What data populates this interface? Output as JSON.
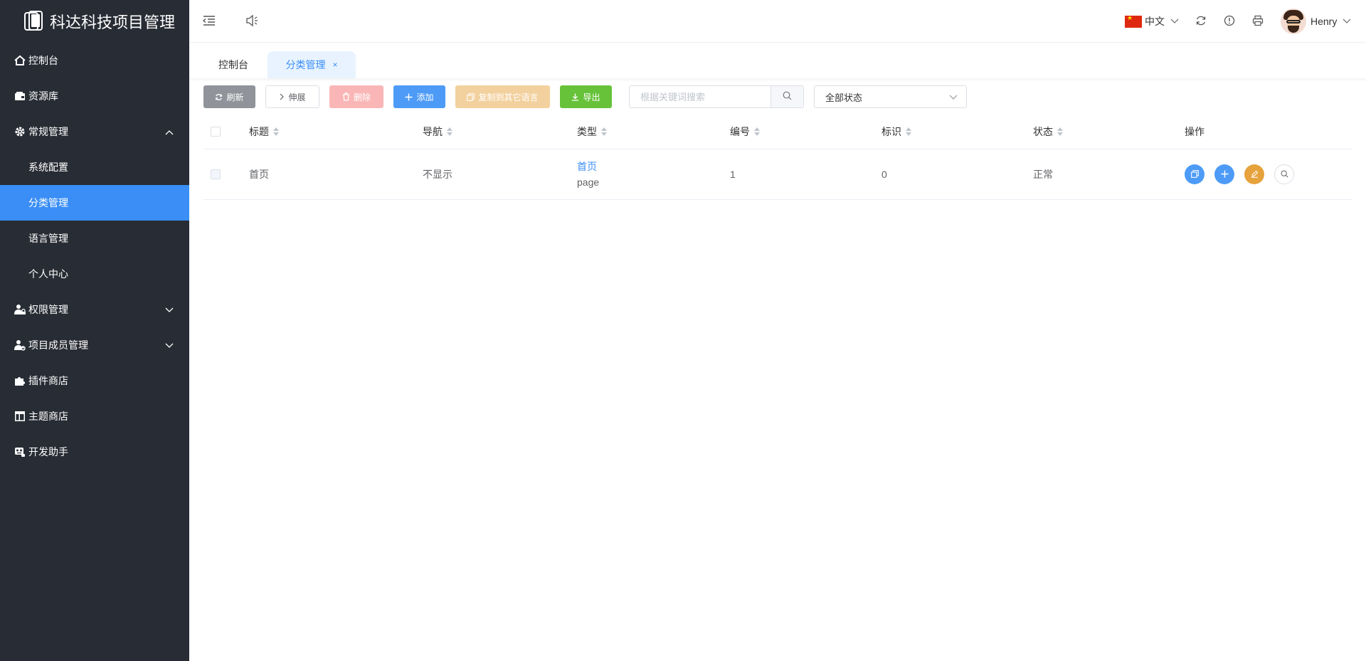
{
  "app": {
    "title": "科达科技项目管理"
  },
  "sidebar": {
    "items": [
      {
        "label": "控制台",
        "icon": "home-icon"
      },
      {
        "label": "资源库",
        "icon": "wallet-icon"
      },
      {
        "label": "常规管理",
        "icon": "gear-icon",
        "expanded": true
      },
      {
        "label": "系统配置"
      },
      {
        "label": "分类管理",
        "active": true
      },
      {
        "label": "语言管理"
      },
      {
        "label": "个人中心"
      },
      {
        "label": "权限管理",
        "icon": "user-lock-icon"
      },
      {
        "label": "项目成员管理",
        "icon": "user-check-icon"
      },
      {
        "label": "插件商店",
        "icon": "puzzle-icon"
      },
      {
        "label": "主题商店",
        "icon": "layout-icon"
      },
      {
        "label": "开发助手",
        "icon": "robot-icon"
      }
    ]
  },
  "header": {
    "language": "中文",
    "username": "Henry"
  },
  "tabs": [
    {
      "label": "控制台"
    },
    {
      "label": "分类管理",
      "active": true,
      "close": "×"
    }
  ],
  "toolbar": {
    "refresh": "刷新",
    "expand": "伸展",
    "delete": "删除",
    "add": "添加",
    "copy_lang": "复制到其它语言",
    "export": "导出",
    "search_placeholder": "根据关键词搜索",
    "status_select": "全部状态"
  },
  "colors": {
    "accent": "#3a8ef6",
    "sidebar_bg": "#282c34",
    "refresh_btn": "#909399",
    "delete_btn": "#fab6b6",
    "copy_btn": "#f3d19e",
    "export_btn": "#67c23a",
    "edit_btn": "#e6a23c"
  },
  "table": {
    "columns": [
      "标题",
      "导航",
      "类型",
      "编号",
      "标识",
      "状态",
      "操作"
    ],
    "rows": [
      {
        "title": "首页",
        "nav": "不显示",
        "type": "首页",
        "type_sub": "page",
        "number": "1",
        "identifier": "0",
        "status": "正常"
      }
    ]
  }
}
